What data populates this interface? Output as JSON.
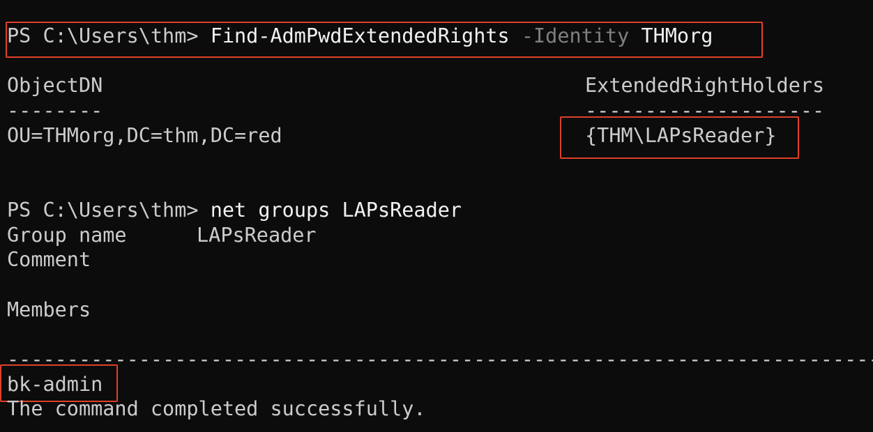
{
  "colors": {
    "background": "#0c0c0c",
    "text": "#cccccc",
    "command": "#f2f2f2",
    "parameter": "#808080",
    "highlight_box": "#e0402a"
  },
  "terminal": {
    "cmd1": {
      "prompt": "PS C:\\Users\\thm> ",
      "command": "Find-AdmPwdExtendedRights",
      "param": "-Identity",
      "arg": "THMorg"
    },
    "table": {
      "col1_header": "ObjectDN",
      "col1_rule": "--------",
      "col1_value": "OU=THMorg,DC=thm,DC=red",
      "col2_header": "ExtendedRightHolders",
      "col2_rule": "--------------------",
      "col2_value": "{THM\\LAPsReader}"
    },
    "cmd2": {
      "prompt": "PS C:\\Users\\thm> ",
      "command": "net",
      "args": "groups LAPsReader"
    },
    "group": {
      "name_label": "Group name",
      "name_value": "LAPsReader",
      "comment_label": "Comment",
      "members_label": "Members",
      "separator": "-------------------------------------------------------------------------------",
      "member": "bk-admin",
      "completion": "The command completed successfully."
    }
  }
}
